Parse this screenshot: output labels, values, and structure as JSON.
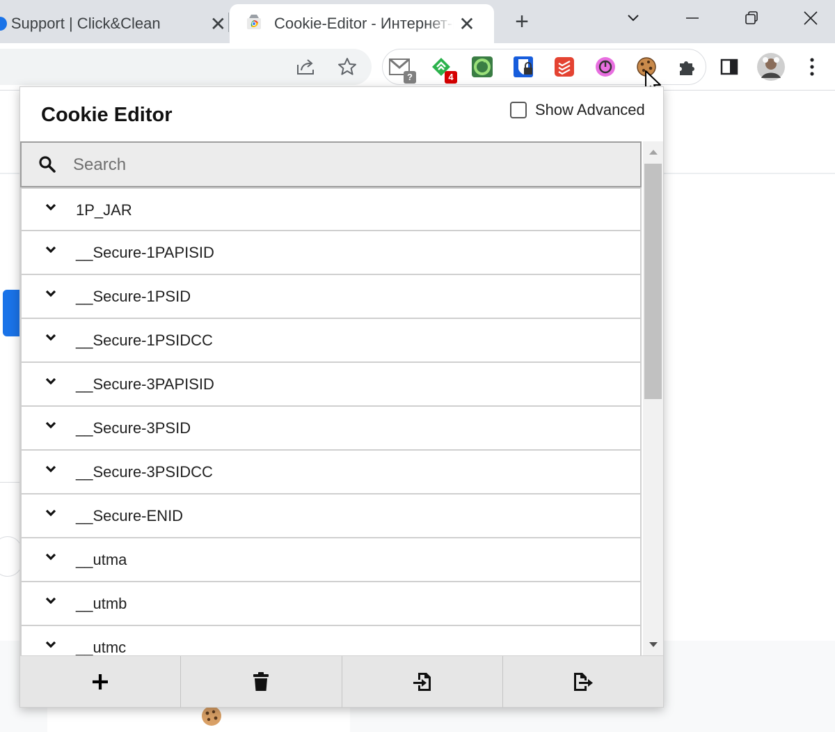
{
  "browser": {
    "tabs": [
      {
        "title": "Support | Click&Clean",
        "active": false
      },
      {
        "title": "Cookie-Editor - Интернет-магазин Chrome",
        "active": true
      }
    ],
    "new_tab_label": "+"
  },
  "toolbar": {
    "extensions": [
      {
        "icon": "mail-checker-icon",
        "badge": "?"
      },
      {
        "icon": "feedly-icon",
        "badge": "4"
      },
      {
        "icon": "click-and-clean-icon",
        "badge": ""
      },
      {
        "icon": "bitwarden-icon",
        "badge": ""
      },
      {
        "icon": "todoist-icon",
        "badge": ""
      },
      {
        "icon": "power-icon",
        "badge": ""
      },
      {
        "icon": "cookie-editor-icon",
        "badge": ""
      }
    ]
  },
  "popup": {
    "title": "Cookie Editor",
    "show_advanced_label": "Show Advanced",
    "show_advanced_checked": false,
    "search_placeholder": "Search",
    "cookies": [
      {
        "name": "1P_JAR"
      },
      {
        "name": "__Secure-1PAPISID"
      },
      {
        "name": "__Secure-1PSID"
      },
      {
        "name": "__Secure-1PSIDCC"
      },
      {
        "name": "__Secure-3PAPISID"
      },
      {
        "name": "__Secure-3PSID"
      },
      {
        "name": "__Secure-3PSIDCC"
      },
      {
        "name": "__Secure-ENID"
      },
      {
        "name": "__utma"
      },
      {
        "name": "__utmb"
      },
      {
        "name": "__utmc"
      }
    ],
    "footer_buttons": [
      {
        "icon": "plus-icon",
        "action": "add"
      },
      {
        "icon": "trash-icon",
        "action": "delete"
      },
      {
        "icon": "import-icon",
        "action": "import"
      },
      {
        "icon": "export-icon",
        "action": "export"
      }
    ]
  }
}
